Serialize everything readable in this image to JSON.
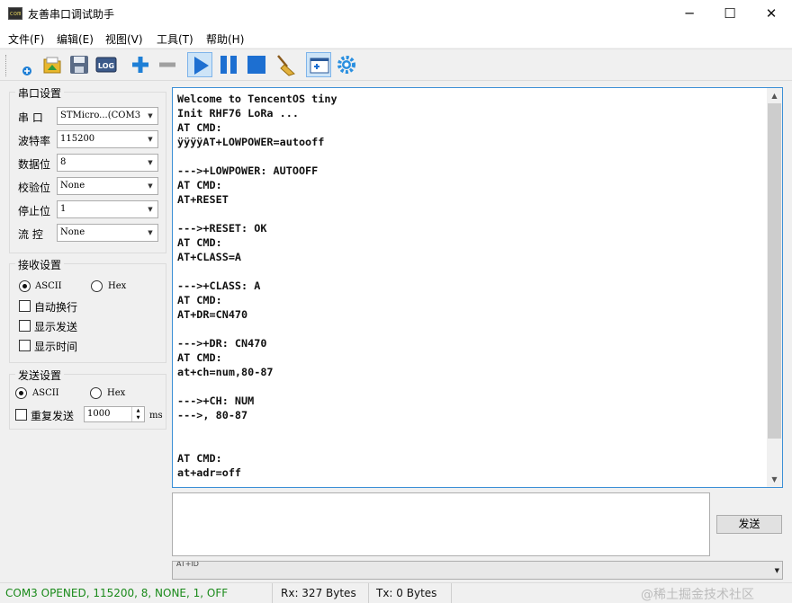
{
  "window": {
    "title": "友善串口调试助手",
    "app_icon_text": "com",
    "minimize_glyph": "─",
    "maximize_glyph": "☐",
    "close_glyph": "✕"
  },
  "menu": [
    "文件(F)",
    "编辑(E)",
    "视图(V)",
    "工具(T)",
    "帮助(H)"
  ],
  "toolbar": {
    "icons": [
      "new-session-icon",
      "open-folder-icon",
      "save-icon",
      "log-icon",
      "add-icon",
      "remove-icon",
      "play-icon",
      "pause-icon",
      "stop-icon",
      "clear-broom-icon",
      "layout-window-icon",
      "settings-gear-icon"
    ],
    "log_label": "LOG",
    "active": "play-icon"
  },
  "serial_settings": {
    "title": "串口设置",
    "port_label": "串  口",
    "port_value": "STMicro...(COM3",
    "baud_label": "波特率",
    "baud_value": "115200",
    "data_bits_label": "数据位",
    "data_bits_value": "8",
    "parity_label": "校验位",
    "parity_value": "None",
    "stop_bits_label": "停止位",
    "stop_bits_value": "1",
    "flow_label": "流  控",
    "flow_value": "None"
  },
  "receive_settings": {
    "title": "接收设置",
    "ascii_label": "ASCII",
    "hex_label": "Hex",
    "mode": "ASCII",
    "auto_wrap_label": "自动换行",
    "show_send_label": "显示发送",
    "show_time_label": "显示时间",
    "auto_wrap": false,
    "show_send": false,
    "show_time": false
  },
  "send_settings": {
    "title": "发送设置",
    "ascii_label": "ASCII",
    "hex_label": "Hex",
    "mode": "ASCII",
    "repeat_label": "重复发送",
    "repeat": false,
    "interval_value": "1000",
    "interval_unit": "ms"
  },
  "receive_area": {
    "lines": [
      "Welcome to TencentOS tiny",
      "Init RHF76 LoRa ...",
      "AT CMD:",
      "ÿÿÿÿAT+LOWPOWER=autooff",
      "",
      "--->+LOWPOWER: AUTOOFF",
      "AT CMD:",
      "AT+RESET",
      "",
      "--->+RESET: OK",
      "AT CMD:",
      "AT+CLASS=A",
      "",
      "--->+CLASS: A",
      "AT CMD:",
      "AT+DR=CN470",
      "",
      "--->+DR: CN470",
      "AT CMD:",
      "at+ch=num,80-87",
      "",
      "--->+CH: NUM",
      "--->, 80-87",
      "",
      "",
      "AT CMD:",
      "at+adr=off"
    ]
  },
  "send_area": {
    "value": "",
    "send_button": "发送",
    "history_value": "AT+ID"
  },
  "status": {
    "connection": "COM3 OPENED, 115200, 8, NONE, 1, OFF",
    "rx": "Rx: 327 Bytes",
    "tx": "Tx: 0 Bytes",
    "watermark": "@稀土掘金技术社区",
    "connection_color": "#1a8a1a"
  }
}
